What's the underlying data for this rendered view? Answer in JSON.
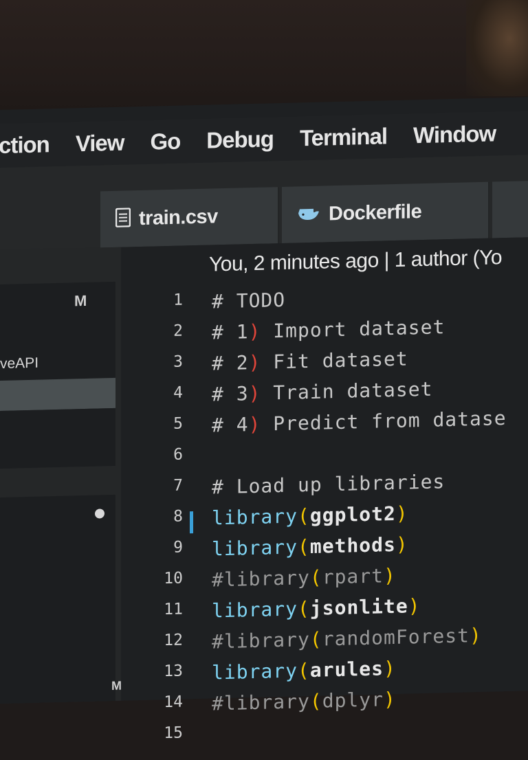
{
  "menubar": {
    "items": [
      "ction",
      "View",
      "Go",
      "Debug",
      "Terminal",
      "Window"
    ]
  },
  "tabs": [
    {
      "label": "train.csv",
      "icon": "file-icon"
    },
    {
      "label": "Dockerfile",
      "icon": "docker-whale-icon"
    }
  ],
  "sidebar": {
    "badge_top": "M",
    "item_text": "veAPI",
    "badge_bottom": "M"
  },
  "editor": {
    "blame": "You, 2 minutes ago | 1 author (Yo",
    "lines": [
      {
        "num": "1",
        "comment": "# TODO"
      },
      {
        "num": "2",
        "prefix": "# 1",
        "paren": ")",
        "rest": " Import dataset"
      },
      {
        "num": "3",
        "prefix": "# 2",
        "paren": ")",
        "rest": " Fit dataset"
      },
      {
        "num": "4",
        "prefix": "# 3",
        "paren": ")",
        "rest": " Train dataset"
      },
      {
        "num": "5",
        "prefix": "# 4",
        "paren": ")",
        "rest": " Predict from datase"
      },
      {
        "num": "6"
      },
      {
        "num": "7",
        "comment": "# Load up libraries"
      },
      {
        "num": "8",
        "fn": "library",
        "open": "(",
        "arg": "ggplot2",
        "close": ")"
      },
      {
        "num": "9",
        "fn": "library",
        "open": "(",
        "arg": "methods",
        "close": ")"
      },
      {
        "num": "10",
        "dim": "#library",
        "open": "(",
        "darg": "rpart",
        "close": ")"
      },
      {
        "num": "11",
        "fn": "library",
        "open": "(",
        "arg": "jsonlite",
        "close": ")"
      },
      {
        "num": "12",
        "dim": "#library",
        "open": "(",
        "darg": "randomForest",
        "close": ")"
      },
      {
        "num": "13",
        "fn": "library",
        "open": "(",
        "arg": "arules",
        "close": ")"
      },
      {
        "num": "14",
        "dim": "#library",
        "open": "(",
        "darg": "dplyr",
        "close": ")"
      },
      {
        "num": "15"
      }
    ]
  },
  "colors": {
    "accent_function": "#7fd3f2",
    "bracket": "#f2c500",
    "number_paren": "#e0453a",
    "git_modified_bar": "#3aa0d8"
  }
}
